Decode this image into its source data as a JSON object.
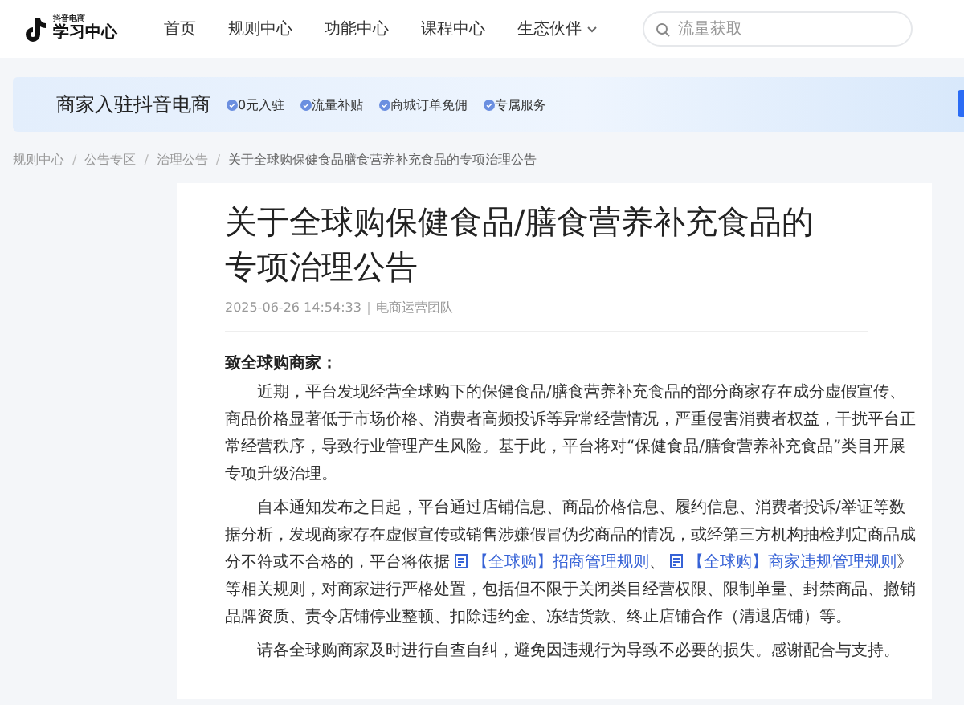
{
  "header": {
    "logo_small": "抖音电商",
    "logo_title": "学习中心",
    "nav": [
      {
        "label": "首页",
        "dropdown": false
      },
      {
        "label": "规则中心",
        "dropdown": false
      },
      {
        "label": "功能中心",
        "dropdown": false
      },
      {
        "label": "课程中心",
        "dropdown": false
      },
      {
        "label": "生态伙伴",
        "dropdown": true
      }
    ],
    "search": {
      "placeholder": "流量获取"
    }
  },
  "banner": {
    "title": "商家入驻抖音电商",
    "features": [
      "0元入驻",
      "流量补贴",
      "商城订单免佣",
      "专属服务"
    ]
  },
  "breadcrumb": {
    "items": [
      "规则中心",
      "公告专区",
      "治理公告",
      "关于全球购保健食品膳食营养补充食品的专项治理公告"
    ],
    "separators": [
      "/",
      "/",
      "/"
    ]
  },
  "article": {
    "title": "关于全球购保健食品/膳食营养补充食品的专项治理公告",
    "datetime": "2025-06-26 14:54:33",
    "author": "电商运营团队",
    "greeting": "致全球购商家：",
    "paragraphs": [
      [
        {
          "kind": "text",
          "text": "近期，平台发现经营全球购下的保健食品/膳食营养补充食品的部分商家存在成分虚假宣传、商品价格显著低于市场价格、消费者高频投诉等异常经营情况，严重侵害消费者权益，干扰平台正常经营秩序，导致行业管理产生风险。基于此，平台将对“保健食品/膳食营养补充食品”类目开展专项升级治理。"
        }
      ],
      [
        {
          "kind": "text",
          "text": "自本通知发布之日起，平台通过店铺信息、商品价格信息、履约信息、消费者投诉/举证等数据分析，发现商家存在虚假宣传或销售涉嫌假冒伪劣商品的情况，或经第三方机构抽检判定商品成分不符或不合格的，平台将依据"
        },
        {
          "kind": "link",
          "text": "【全球购】招商管理规则"
        },
        {
          "kind": "text",
          "text": "、"
        },
        {
          "kind": "link",
          "text": "【全球购】商家违规管理规则"
        },
        {
          "kind": "text",
          "text": "》等相关规则，对商家进行严格处置，包括但不限于关闭类目经营权限、限制单量、封禁商品、撤销品牌资质、责令店铺停业整顿、扣除违约金、冻结货款、终止店铺合作（清退店铺）等。"
        }
      ],
      [
        {
          "kind": "text",
          "text": "请各全球购商家及时进行自查自纠，避免因违规行为导致不必要的损失。感谢配合与支持。"
        }
      ]
    ]
  }
}
